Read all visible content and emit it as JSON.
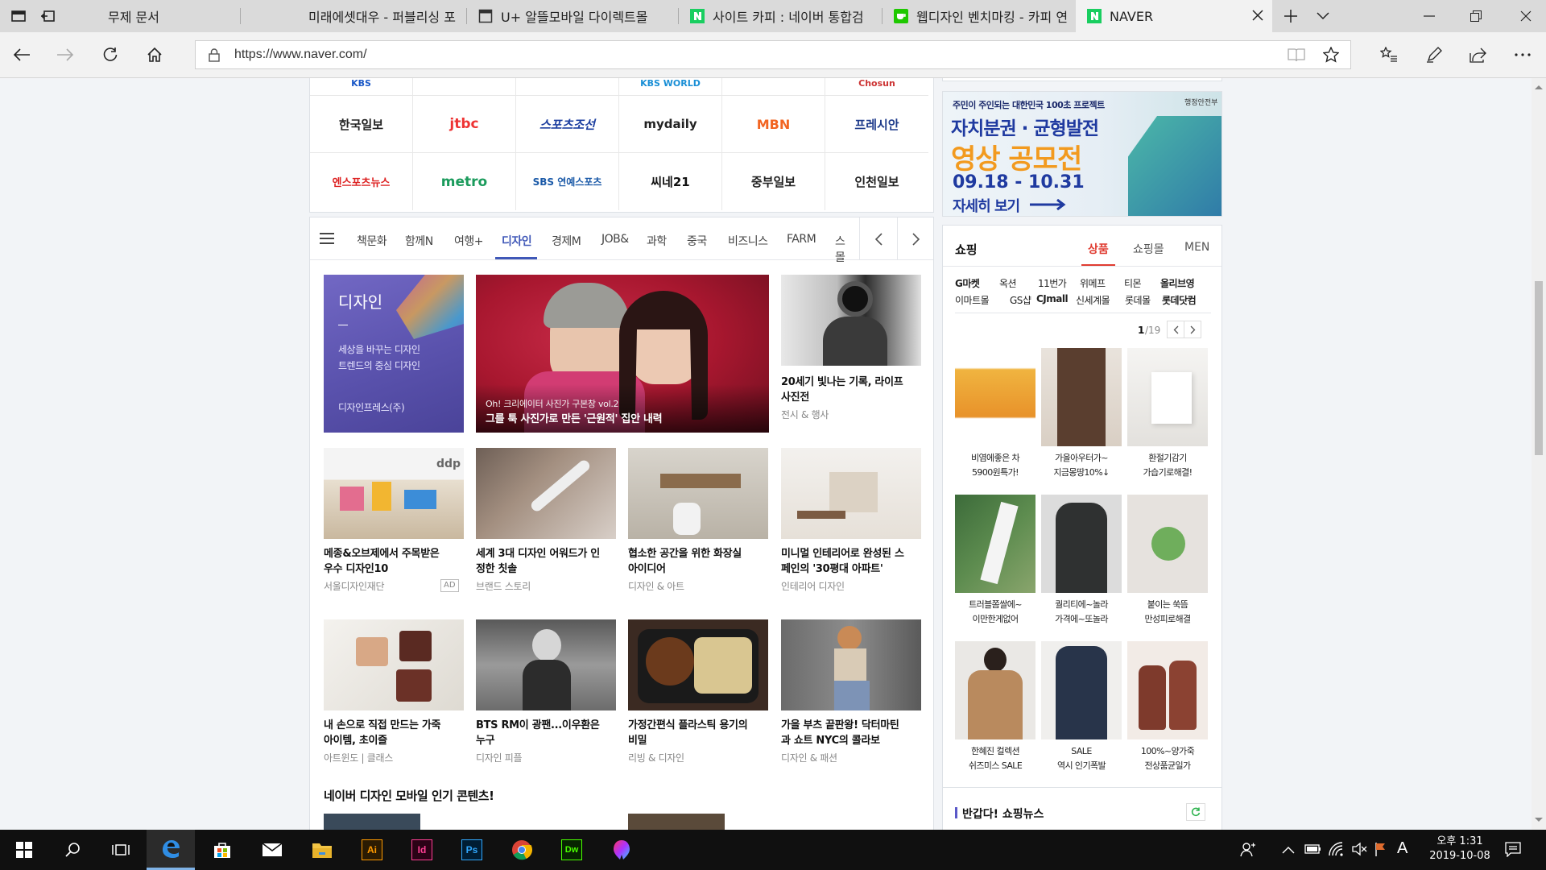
{
  "browser": {
    "tabs": [
      {
        "title": "무제 문서",
        "icon": "document-icon"
      },
      {
        "title": "미래에셋대우 - 퍼블리싱 포",
        "icon": "none"
      },
      {
        "title": "U+ 알뜰모바일 다이렉트몰",
        "icon": "page-icon"
      },
      {
        "title": "사이트 카피 : 네이버 통합검",
        "icon": "naver-icon"
      },
      {
        "title": "웹디자인 벤치마킹 - 카피 연",
        "icon": "naver-icon"
      },
      {
        "title": "NAVER",
        "icon": "naver-icon"
      }
    ],
    "url": "https://www.naver.com/"
  },
  "press": {
    "row0": [
      "KBS",
      "KBS WORLD",
      "Chosun"
    ],
    "row1": [
      "한국일보",
      "jtbc",
      "스포츠조선",
      "mydaily",
      "MBN",
      "프레시안"
    ],
    "row2": [
      "엔스포츠뉴스",
      "metro",
      "SBS 연예스포츠",
      "씨네21",
      "중부일보",
      "인천일보"
    ]
  },
  "banner": {
    "top": "주민이 주인되는 대한민국 100초 프로젝트",
    "org": "행정안전부",
    "line1": "자치분권 · 균형발전",
    "line2": "영상 공모전",
    "dates": "09.18 - 10.31",
    "cta": "자세히 보기"
  },
  "categories": [
    "책문화",
    "함께N",
    "여행+",
    "디자인",
    "경제M",
    "JOB&",
    "과학",
    "중국",
    "비즈니스",
    "FARM",
    "스몰"
  ],
  "selected_category": "디자인",
  "design": {
    "title": "디자인",
    "desc1": "세상을 바꾸는 디자인",
    "desc2": "트렌드의 중심 디자인",
    "publisher": "디자인프레스(주)"
  },
  "feature": {
    "kicker": "Oh! 크리에이터 사진가 구본창 vol.2",
    "title": "그를 툭 사진가로 만든 '근원적' 집안 내력"
  },
  "side_story": {
    "title1": "20세기 빛나는 기록, 라이프",
    "title2": "사진전",
    "src": "전시 & 행사"
  },
  "grid": [
    {
      "t1": "메종&오브제에서 주목받은",
      "t2": "우수 디자인10",
      "src": "서울디자인재단",
      "badge": "AD"
    },
    {
      "t1": "세계 3대 디자인 어워드가 인",
      "t2": "정한 칫솔",
      "src": "브랜드 스토리"
    },
    {
      "t1": "협소한 공간을 위한 화장실",
      "t2": "아이디어",
      "src": "디자인 & 아트"
    },
    {
      "t1": "미니멀 인테리어로 완성된 스",
      "t2": "페인의 '30평대 아파트'",
      "src": "인테리어 디자인"
    },
    {
      "t1": "내 손으로 직접 만드는 가죽",
      "t2": "아이템, 초이즐",
      "src": "아트윈도 | 클래스"
    },
    {
      "t1": "BTS RM이 광팬...이우환은",
      "t2": "누구",
      "src": "디자인 피플"
    },
    {
      "t1": "가정간편식 플라스틱 용기의",
      "t2": "비밀",
      "src": "리빙 & 디자인"
    },
    {
      "t1": "가을 부츠 끝판왕! 닥터마틴",
      "t2": "과 쇼트 NYC의 콜라보",
      "src": "디자인 & 패션"
    }
  ],
  "mobile_heading": "네이버 디자인 모바일 인기 콘텐츠!",
  "shopping": {
    "title": "쇼핑",
    "tabs": [
      "상품",
      "쇼핑몰",
      "MEN"
    ],
    "cats_row1": [
      "G마켓",
      "옥션",
      "11번가",
      "위메프",
      "티몬",
      "올리브영"
    ],
    "cats_row2": [
      "이마트몰",
      "GS샵",
      "CJmall",
      "신세계몰",
      "롯데몰",
      "롯데닷컴"
    ],
    "page_current": "1",
    "page_total": "/19",
    "products": [
      {
        "l1": "비염에좋은 차",
        "l2": "5900원특가!"
      },
      {
        "l1": "가을아우터가~",
        "l2": "지금몽땅10%↓"
      },
      {
        "l1": "환절기감기",
        "l2": "가습기로해결!"
      },
      {
        "l1": "트러블쫌쌀에~",
        "l2": "이만한게없어"
      },
      {
        "l1": "퀄리티에~놀라",
        "l2": "가격에~또놀라"
      },
      {
        "l1": "붙이는 쑥뜸",
        "l2": "만성피로해결"
      },
      {
        "l1": "한혜진 컬렉션",
        "l2": "쉬즈미스 SALE"
      },
      {
        "l1": "SALE",
        "l2": "역시 인기폭발"
      },
      {
        "l1": "100%~양가죽",
        "l2": "전상품균일가"
      }
    ],
    "news_title": "반갑다! 쇼핑뉴스"
  },
  "taskbar": {
    "time": "오후 1:31",
    "date": "2019-10-08",
    "ime": "A"
  }
}
